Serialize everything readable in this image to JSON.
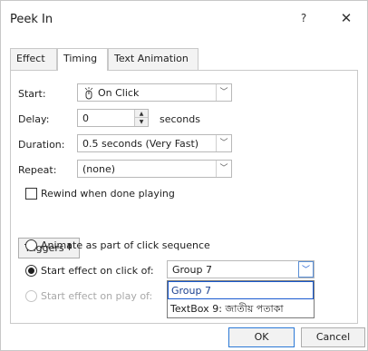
{
  "window": {
    "title": "Peek In",
    "help_label": "?",
    "close_label": "✕"
  },
  "tabs": [
    {
      "label": "Effect"
    },
    {
      "label": "Timing"
    },
    {
      "label": "Text Animation"
    }
  ],
  "timing": {
    "start_label": "Start:",
    "start_value": "On Click",
    "start_icon": "mouse-click-icon",
    "delay_label": "Delay:",
    "delay_value": "0",
    "delay_unit": "seconds",
    "duration_label": "Duration:",
    "duration_value": "0.5 seconds (Very Fast)",
    "repeat_label": "Repeat:",
    "repeat_value": "(none)",
    "rewind_label": "Rewind when done playing",
    "rewind_checked": false
  },
  "triggers": {
    "button_label": "Triggers",
    "animate_sequence_label": "Animate as part of click sequence",
    "start_on_click_label": "Start effect on click of:",
    "start_on_click_value": "Group 7",
    "start_on_play_label": "Start effect on play of:",
    "selected_option": "start_on_click",
    "options": [
      "Group 7",
      "TextBox 9: জাতীয় পতাকা"
    ]
  },
  "footer": {
    "ok_label": "OK",
    "cancel_label": "Cancel"
  },
  "colors": {
    "accent": "#2b79d6",
    "selected_item_border": "#1a5bd0"
  }
}
